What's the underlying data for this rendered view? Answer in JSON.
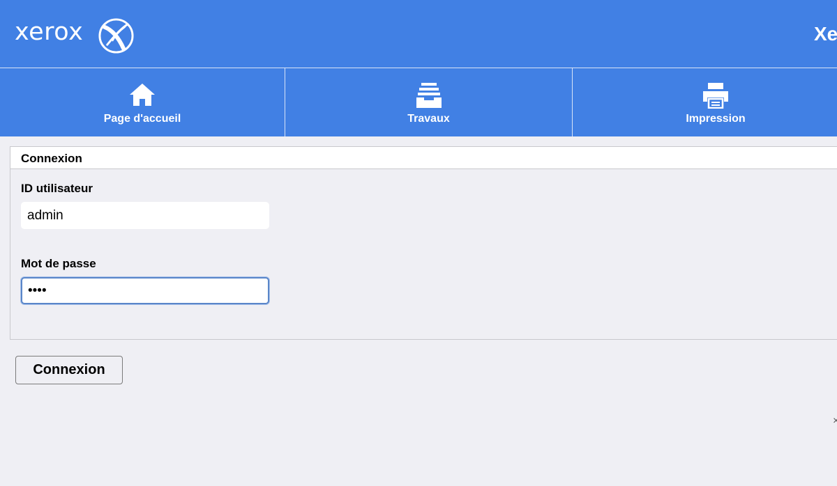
{
  "header": {
    "logo_text": "xerox",
    "title": "Xe"
  },
  "nav": {
    "tabs": [
      {
        "label": "Page d'accueil",
        "icon": "home-icon"
      },
      {
        "label": "Travaux",
        "icon": "jobs-tray-icon"
      },
      {
        "label": "Impression",
        "icon": "printer-icon"
      }
    ]
  },
  "login": {
    "section_title": "Connexion",
    "user_id_label": "ID utilisateur",
    "user_id_value": "admin",
    "password_label": "Mot de passe",
    "password_value": "••••",
    "submit_label": "Connexion"
  },
  "edge_glyph": "×",
  "colors": {
    "brand_blue": "#4180e4",
    "background": "#efeff4",
    "focus_ring": "#5a86c9"
  }
}
